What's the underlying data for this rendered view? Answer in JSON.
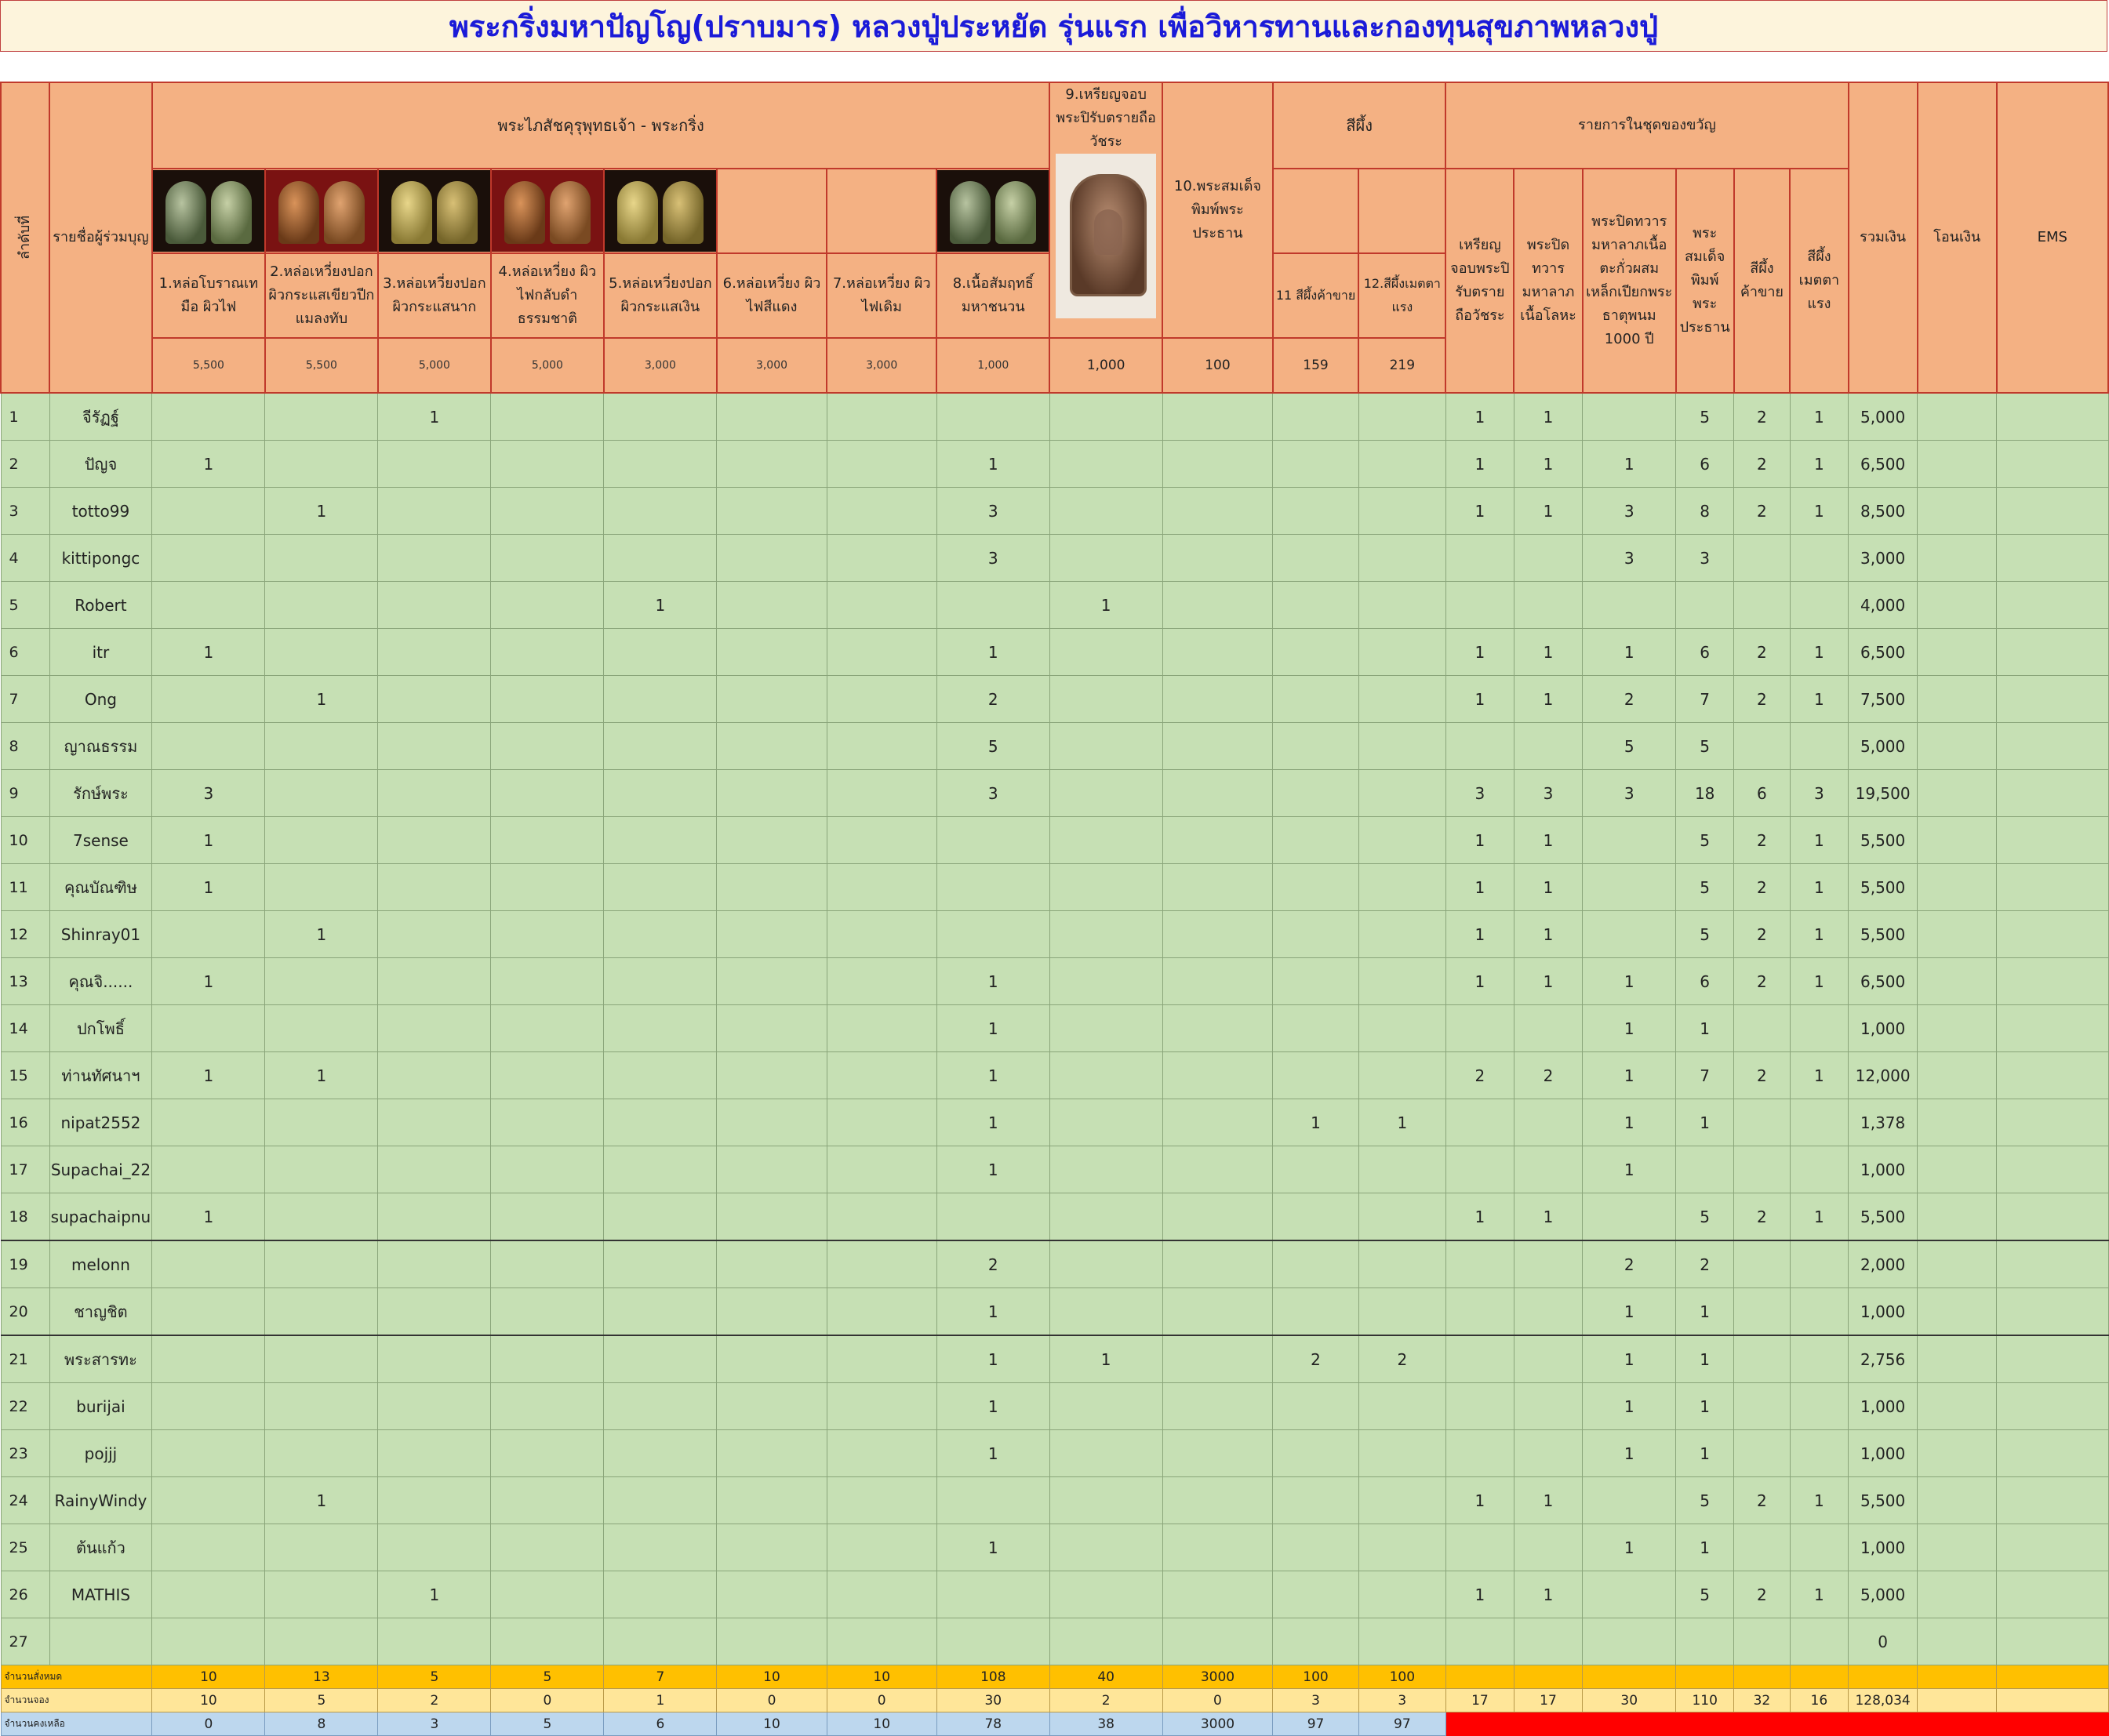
{
  "title": "พระกริ่งมหาปัญโญ(ปราบมาร) หลวงปู่ประหยัด รุ่นแรก เพื่อวิหารทานและกองทุนสุขภาพหลวงปู่",
  "header": {
    "row_no": "ลำดับที่",
    "member_list": "รายชื่อผู้ร่วมบุญ",
    "group_main": "พระไภสัชคุรุพุทธเจ้า - พระกริ่ง",
    "col9": "9.เหรียญจอบพระปิรับตรายถือวัชระ",
    "col10": "10.พระสมเด็จพิมพ์พระประธาน",
    "group_sipueng": "สีผึ้ง",
    "group_set": "รายการในชุดของขวัญ",
    "total": "รวมเงิน",
    "transfer": "โอนเงิน",
    "ems": "EMS",
    "items": [
      "1.หล่อโบราณเทมือ ผิวไฟ",
      "2.หล่อเหวี่ยงปอกผิวกระแสเขียวปีกแมลงทับ",
      "3.หล่อเหวี่ยงปอกผิวกระแสนาก",
      "4.หล่อเหวี่ยง ผิวไฟกลับดำธรรมชาติ",
      "5.หล่อเหวี่ยงปอกผิวกระแสเงิน",
      "6.หล่อเหวี่ยง ผิวไฟสีแดง",
      "7.หล่อเหวี่ยง ผิวไฟเดิม",
      "8.เนื้อสัมฤทธิ์มหาชนวน"
    ],
    "sipueng_items": [
      "11 สีผึ้งค้าขาย",
      "12.สีผึ้งเมตตาแรง"
    ],
    "set_items": [
      "เหรียญจอบพระปิรับตรายถือวัชระ",
      "พระปิดทวารมหาลาภเนื้อโลหะ",
      "พระปิดทวารมหาลาภเนื้อตะกั่วผสมเหล็กเปียกพระธาตุพนม 1000 ปี",
      "พระสมเด็จพิมพ์พระประธาน",
      "สีผึ้งค้าขาย",
      "สีผึ้งเมตตาแรง"
    ],
    "prices": [
      "5,500",
      "5,500",
      "5,000",
      "5,000",
      "3,000",
      "3,000",
      "3,000",
      "1,000",
      "1,000",
      "100",
      "159",
      "219"
    ]
  },
  "rows": [
    {
      "no": "1",
      "name": "จีรัฏฐ์",
      "v": [
        "",
        "",
        "1",
        "",
        "",
        "",
        "",
        "",
        "",
        "",
        "",
        "",
        "1",
        "1",
        "",
        "5",
        "2",
        "1",
        "5,000",
        "",
        ""
      ]
    },
    {
      "no": "2",
      "name": "ปัญจ",
      "v": [
        "1",
        "",
        "",
        "",
        "",
        "",
        "",
        "1",
        "",
        "",
        "",
        "",
        "1",
        "1",
        "1",
        "6",
        "2",
        "1",
        "6,500",
        "",
        ""
      ]
    },
    {
      "no": "3",
      "name": "totto99",
      "v": [
        "",
        "1",
        "",
        "",
        "",
        "",
        "",
        "3",
        "",
        "",
        "",
        "",
        "1",
        "1",
        "3",
        "8",
        "2",
        "1",
        "8,500",
        "",
        ""
      ]
    },
    {
      "no": "4",
      "name": "kittipongc",
      "v": [
        "",
        "",
        "",
        "",
        "",
        "",
        "",
        "3",
        "",
        "",
        "",
        "",
        "",
        "",
        "3",
        "3",
        "",
        "",
        "3,000",
        "",
        ""
      ]
    },
    {
      "no": "5",
      "name": "Robert",
      "v": [
        "",
        "",
        "",
        "",
        "1",
        "",
        "",
        "",
        "1",
        "",
        "",
        "",
        "",
        "",
        "",
        "",
        "",
        "",
        "4,000",
        "",
        ""
      ]
    },
    {
      "no": "6",
      "name": "itr",
      "v": [
        "1",
        "",
        "",
        "",
        "",
        "",
        "",
        "1",
        "",
        "",
        "",
        "",
        "1",
        "1",
        "1",
        "6",
        "2",
        "1",
        "6,500",
        "",
        ""
      ]
    },
    {
      "no": "7",
      "name": "Ong",
      "v": [
        "",
        "1",
        "",
        "",
        "",
        "",
        "",
        "2",
        "",
        "",
        "",
        "",
        "1",
        "1",
        "2",
        "7",
        "2",
        "1",
        "7,500",
        "",
        ""
      ]
    },
    {
      "no": "8",
      "name": "ญาณธรรม",
      "v": [
        "",
        "",
        "",
        "",
        "",
        "",
        "",
        "5",
        "",
        "",
        "",
        "",
        "",
        "",
        "5",
        "5",
        "",
        "",
        "5,000",
        "",
        ""
      ]
    },
    {
      "no": "9",
      "name": "รักษ์พระ",
      "v": [
        "3",
        "",
        "",
        "",
        "",
        "",
        "",
        "3",
        "",
        "",
        "",
        "",
        "3",
        "3",
        "3",
        "18",
        "6",
        "3",
        "19,500",
        "",
        ""
      ]
    },
    {
      "no": "10",
      "name": "7sense",
      "v": [
        "1",
        "",
        "",
        "",
        "",
        "",
        "",
        "",
        "",
        "",
        "",
        "",
        "1",
        "1",
        "",
        "5",
        "2",
        "1",
        "5,500",
        "",
        ""
      ]
    },
    {
      "no": "11",
      "name": "คุณบัณฑิษ",
      "v": [
        "1",
        "",
        "",
        "",
        "",
        "",
        "",
        "",
        "",
        "",
        "",
        "",
        "1",
        "1",
        "",
        "5",
        "2",
        "1",
        "5,500",
        "",
        ""
      ]
    },
    {
      "no": "12",
      "name": "Shinray01",
      "v": [
        "",
        "1",
        "",
        "",
        "",
        "",
        "",
        "",
        "",
        "",
        "",
        "",
        "1",
        "1",
        "",
        "5",
        "2",
        "1",
        "5,500",
        "",
        ""
      ]
    },
    {
      "no": "13",
      "name": "คุณจิ......",
      "v": [
        "1",
        "",
        "",
        "",
        "",
        "",
        "",
        "1",
        "",
        "",
        "",
        "",
        "1",
        "1",
        "1",
        "6",
        "2",
        "1",
        "6,500",
        "",
        ""
      ]
    },
    {
      "no": "14",
      "name": "ปกโพธิ์",
      "v": [
        "",
        "",
        "",
        "",
        "",
        "",
        "",
        "1",
        "",
        "",
        "",
        "",
        "",
        "",
        "1",
        "1",
        "",
        "",
        "1,000",
        "",
        ""
      ]
    },
    {
      "no": "15",
      "name": "ท่านทัศนาฯ",
      "v": [
        "1",
        "1",
        "",
        "",
        "",
        "",
        "",
        "1",
        "",
        "",
        "",
        "",
        "2",
        "2",
        "1",
        "7",
        "2",
        "1",
        "12,000",
        "",
        ""
      ]
    },
    {
      "no": "16",
      "name": "nipat2552",
      "v": [
        "",
        "",
        "",
        "",
        "",
        "",
        "",
        "1",
        "",
        "",
        "1",
        "1",
        "",
        "",
        "1",
        "1",
        "",
        "",
        "1,378",
        "",
        ""
      ]
    },
    {
      "no": "17",
      "name": "Supachai_22",
      "v": [
        "",
        "",
        "",
        "",
        "",
        "",
        "",
        "1",
        "",
        "",
        "",
        "",
        "",
        "",
        "1",
        "",
        "",
        "",
        "1,000",
        "",
        ""
      ]
    },
    {
      "no": "18",
      "name": "supachaipnu",
      "v": [
        "1",
        "",
        "",
        "",
        "",
        "",
        "",
        "",
        "",
        "",
        "",
        "",
        "1",
        "1",
        "",
        "5",
        "2",
        "1",
        "5,500",
        "",
        ""
      ]
    },
    {
      "no": "19",
      "name": "melonn",
      "v": [
        "",
        "",
        "",
        "",
        "",
        "",
        "",
        "2",
        "",
        "",
        "",
        "",
        "",
        "",
        "2",
        "2",
        "",
        "",
        "2,000",
        "",
        ""
      ]
    },
    {
      "no": "20",
      "name": "ชาญชิต",
      "v": [
        "",
        "",
        "",
        "",
        "",
        "",
        "",
        "1",
        "",
        "",
        "",
        "",
        "",
        "",
        "1",
        "1",
        "",
        "",
        "1,000",
        "",
        ""
      ]
    },
    {
      "no": "21",
      "name": "พระสารทะ",
      "v": [
        "",
        "",
        "",
        "",
        "",
        "",
        "",
        "1",
        "1",
        "",
        "2",
        "2",
        "",
        "",
        "1",
        "1",
        "",
        "",
        "2,756",
        "",
        ""
      ]
    },
    {
      "no": "22",
      "name": "burijai",
      "v": [
        "",
        "",
        "",
        "",
        "",
        "",
        "",
        "1",
        "",
        "",
        "",
        "",
        "",
        "",
        "1",
        "1",
        "",
        "",
        "1,000",
        "",
        ""
      ]
    },
    {
      "no": "23",
      "name": "pojjj",
      "v": [
        "",
        "",
        "",
        "",
        "",
        "",
        "",
        "1",
        "",
        "",
        "",
        "",
        "",
        "",
        "1",
        "1",
        "",
        "",
        "1,000",
        "",
        ""
      ]
    },
    {
      "no": "24",
      "name": "RainyWindy",
      "v": [
        "",
        "1",
        "",
        "",
        "",
        "",
        "",
        "",
        "",
        "",
        "",
        "",
        "1",
        "1",
        "",
        "5",
        "2",
        "1",
        "5,500",
        "",
        ""
      ]
    },
    {
      "no": "25",
      "name": "ต้นแก้ว",
      "v": [
        "",
        "",
        "",
        "",
        "",
        "",
        "",
        "1",
        "",
        "",
        "",
        "",
        "",
        "",
        "1",
        "1",
        "",
        "",
        "1,000",
        "",
        ""
      ]
    },
    {
      "no": "26",
      "name": "MATHIS",
      "v": [
        "",
        "",
        "1",
        "",
        "",
        "",
        "",
        "",
        "",
        "",
        "",
        "",
        "1",
        "1",
        "",
        "5",
        "2",
        "1",
        "5,000",
        "",
        ""
      ]
    },
    {
      "no": "27",
      "name": "",
      "v": [
        "",
        "",
        "",
        "",
        "",
        "",
        "",
        "",
        "",
        "",
        "",
        "",
        "",
        "",
        "",
        "",
        "",
        "",
        "0",
        "",
        ""
      ]
    }
  ],
  "summary": [
    {
      "label": "จำนวนสั่งหมด",
      "v": [
        "10",
        "13",
        "5",
        "5",
        "7",
        "10",
        "10",
        "108",
        "40",
        "3000",
        "100",
        "100",
        "",
        "",
        "",
        "",
        "",
        "",
        "",
        "",
        ""
      ]
    },
    {
      "label": "จำนวนจอง",
      "v": [
        "10",
        "5",
        "2",
        "0",
        "1",
        "0",
        "0",
        "30",
        "2",
        "0",
        "3",
        "3",
        "17",
        "17",
        "30",
        "110",
        "32",
        "16",
        "128,034",
        "",
        ""
      ]
    },
    {
      "label": "จำนวนคงเหลือ",
      "v": [
        "0",
        "8",
        "3",
        "5",
        "6",
        "10",
        "10",
        "78",
        "38",
        "3000",
        "97",
        "97",
        "",
        "",
        "",
        "",
        "",
        "",
        "",
        "",
        ""
      ]
    }
  ]
}
